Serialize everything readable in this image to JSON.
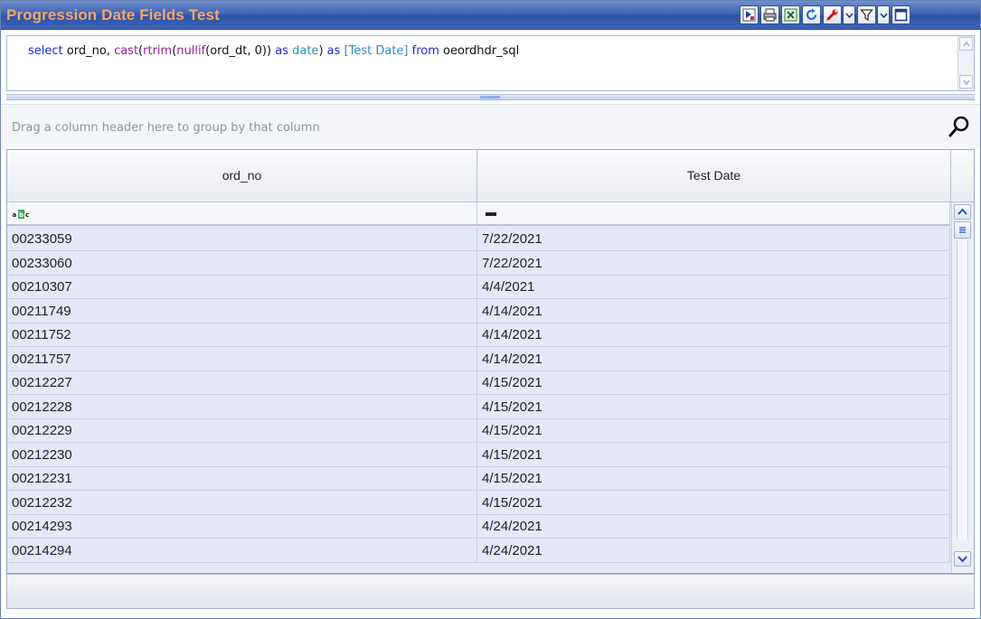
{
  "window": {
    "title": "Progression Date Fields Test"
  },
  "toolbar": {
    "icons": [
      "run-query-icon",
      "print-icon",
      "export-excel-icon",
      "refresh-icon",
      "settings-wrench-icon",
      "dropdown-icon",
      "filter-icon",
      "dropdown-icon",
      "maximize-icon"
    ]
  },
  "editor": {
    "tokens": [
      {
        "t": "select",
        "c": "kw"
      },
      {
        "t": " ord_no, ",
        "c": "pl"
      },
      {
        "t": "cast",
        "c": "fn"
      },
      {
        "t": "(",
        "c": "pl"
      },
      {
        "t": "rtrim",
        "c": "fn"
      },
      {
        "t": "(",
        "c": "pl"
      },
      {
        "t": "nullif",
        "c": "fn"
      },
      {
        "t": "(ord_dt, 0)) ",
        "c": "pl"
      },
      {
        "t": "as",
        "c": "kw"
      },
      {
        "t": " ",
        "c": "pl"
      },
      {
        "t": "date",
        "c": "ty"
      },
      {
        "t": ") ",
        "c": "pl"
      },
      {
        "t": "as",
        "c": "kw"
      },
      {
        "t": " ",
        "c": "pl"
      },
      {
        "t": "[Test Date]",
        "c": "br"
      },
      {
        "t": " ",
        "c": "pl"
      },
      {
        "t": "from",
        "c": "kw"
      },
      {
        "t": " oeordhdr_sql",
        "c": "pl"
      }
    ]
  },
  "group_panel": {
    "hint": "Drag a column header here to group by that column"
  },
  "grid": {
    "columns": [
      "ord_no",
      "Test Date"
    ],
    "rows": [
      [
        "00233059",
        "7/22/2021"
      ],
      [
        "00233060",
        "7/22/2021"
      ],
      [
        "00210307",
        "4/4/2021"
      ],
      [
        "00211749",
        "4/14/2021"
      ],
      [
        "00211752",
        "4/14/2021"
      ],
      [
        "00211757",
        "4/14/2021"
      ],
      [
        "00212227",
        "4/15/2021"
      ],
      [
        "00212228",
        "4/15/2021"
      ],
      [
        "00212229",
        "4/15/2021"
      ],
      [
        "00212230",
        "4/15/2021"
      ],
      [
        "00212231",
        "4/15/2021"
      ],
      [
        "00212232",
        "4/15/2021"
      ],
      [
        "00214293",
        "4/24/2021"
      ],
      [
        "00214294",
        "4/24/2021"
      ]
    ]
  },
  "colors": {
    "title_text": "#f4a76a",
    "title_bar": "#3f63b3",
    "row_bg": "#e4e8f7"
  }
}
